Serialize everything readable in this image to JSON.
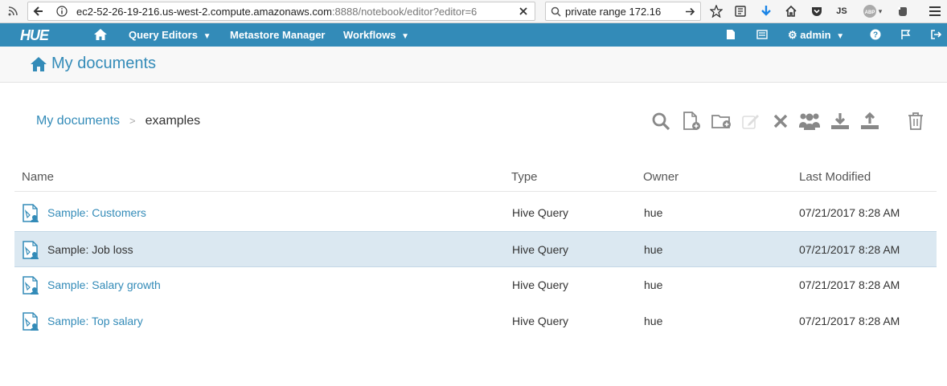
{
  "browser": {
    "url_host": "ec2-52-26-19-216.us-west-2.compute.amazonaws.com",
    "url_path": ":8888/notebook/editor?editor=6",
    "search_text": "private range 172.16",
    "js_label": "JS",
    "abp_label": "ABP"
  },
  "nav": {
    "logo": "HUE",
    "query_editors": "Query Editors",
    "metastore": "Metastore Manager",
    "workflows": "Workflows",
    "user": "admin"
  },
  "page": {
    "title": "My documents"
  },
  "breadcrumb": {
    "root": "My documents",
    "separator": ">",
    "current": "examples"
  },
  "table": {
    "headers": [
      "Name",
      "Type",
      "Owner",
      "Last Modified"
    ],
    "rows": [
      {
        "name": "Sample: Customers",
        "type": "Hive Query",
        "owner": "hue",
        "modified": "07/21/2017 8:28 AM",
        "selected": false
      },
      {
        "name": "Sample: Job loss",
        "type": "Hive Query",
        "owner": "hue",
        "modified": "07/21/2017 8:28 AM",
        "selected": true
      },
      {
        "name": "Sample: Salary growth",
        "type": "Hive Query",
        "owner": "hue",
        "modified": "07/21/2017 8:28 AM",
        "selected": false
      },
      {
        "name": "Sample: Top salary",
        "type": "Hive Query",
        "owner": "hue",
        "modified": "07/21/2017 8:28 AM",
        "selected": false
      }
    ]
  },
  "colors": {
    "brand": "#338bb8",
    "selected_row": "#dbe8f1",
    "icon_gray": "#9a9a9a"
  }
}
